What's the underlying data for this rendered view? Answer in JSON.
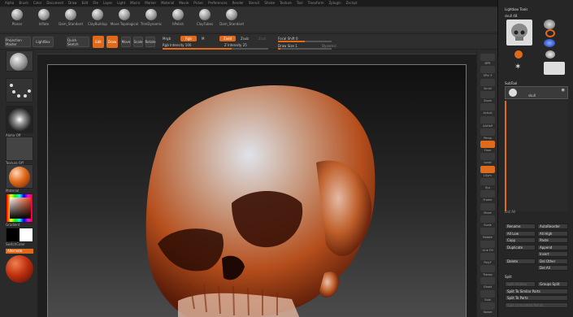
{
  "menu": [
    "Alpha",
    "Brush",
    "Color",
    "Document",
    "Draw",
    "Edit",
    "File",
    "Layer",
    "Light",
    "Macro",
    "Marker",
    "Material",
    "Movie",
    "Picker",
    "Preferences",
    "Render",
    "Stencil",
    "Stroke",
    "Texture",
    "Tool",
    "Transform",
    "Zplugin",
    "Zscript"
  ],
  "shelf": [
    {
      "label": "Planar"
    },
    {
      "label": "Inflate"
    },
    {
      "label": "Dam_Standard"
    },
    {
      "label": "ClayBuildup"
    },
    {
      "label": "Move Topological"
    },
    {
      "label": "TrimDynamic"
    },
    {
      "label": "hPolish"
    },
    {
      "label": "ClayTubes"
    },
    {
      "label": "Dam_Standard"
    }
  ],
  "toolbar": {
    "projection_master": "Projection Master",
    "lightbox": "LightBox",
    "quick_sketch": "Quick Sketch",
    "edit": "Edit",
    "draw": "Draw",
    "move": "Move",
    "scale": "Scale",
    "rotate": "Rotate",
    "mrgb": "Mrgb",
    "rgb": "Rgb",
    "m": "M",
    "zadd": "Zadd",
    "zsub": "Zsub",
    "zcut": "Zcut",
    "rgb_intensity": "Rgb Intensity 100",
    "z_intensity": "Z Intensity 25",
    "focal_shift": "Focal Shift 0",
    "draw_size": "Draw Size 1",
    "dynamic": "Dynamic"
  },
  "left": {
    "alpha_label": "Alpha Off",
    "texture_label": "Texture Off",
    "material_label": "Material",
    "gradient": "Gradient",
    "switch_color": "SwitchColor",
    "alternate": "Alternate",
    "color_accent": "#e06a1a"
  },
  "right_shelf": [
    "BPR",
    "SPix 3",
    "Scroll",
    "Zoom",
    "Actual",
    "AAHalf",
    "Persp",
    "Floor",
    "Local",
    "LSym",
    "Xyz",
    "Frame",
    "Move",
    "Scale",
    "Rotate",
    "Line Fill",
    "PolyF",
    "Transp",
    "Ghost",
    "Solo",
    "Xpose"
  ],
  "tray": {
    "title": "Lightbox Tools",
    "current_tool": "skull 48",
    "tools": [
      "Skull",
      "SphereBrush",
      "AlphaBrush",
      "SimpleBrush",
      "EraserBrush",
      "PolyMesh3D",
      "Skull"
    ],
    "subtool": "SubTool",
    "subtool_item": "skull",
    "list_all": "List All",
    "buttons": [
      [
        "Rename",
        "AutoReorder"
      ],
      [
        "All Low",
        "All High"
      ],
      [
        "Copy",
        "Paste"
      ],
      [
        "Duplicate",
        "Append"
      ],
      [
        "",
        "Insert"
      ],
      [
        "Delete",
        "Del Other"
      ],
      [
        "",
        "Del All"
      ]
    ],
    "split": "Split",
    "split_items": [
      "Split Hidden",
      "Groups Split",
      "Split To Similar Parts",
      "Split To Parts",
      "Split Unmasked Points"
    ]
  }
}
